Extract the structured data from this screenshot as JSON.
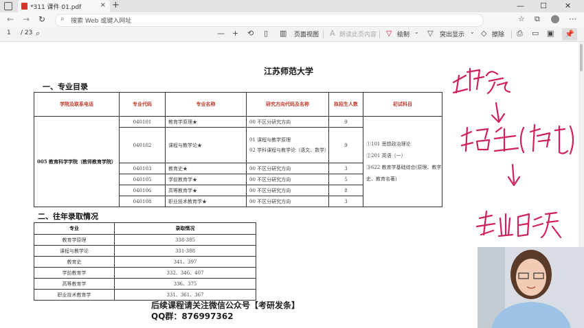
{
  "window": {
    "tab_title": "*311 课件 01.pdf",
    "close_glyph": "×",
    "new_tab_glyph": "+",
    "minimize_glyph": "—",
    "maximize_glyph": "☐",
    "window_close_glyph": "✕"
  },
  "addressbar": {
    "placeholder": "搜索 Web 或键入网址"
  },
  "pdf_toolbar": {
    "page_current": "1",
    "page_total": "/ 23",
    "zoom_out": "—",
    "zoom_in": "+",
    "page_view": "页面视图",
    "read_aloud": "朗读此页内容",
    "draw": "绘制",
    "highlight": "突出显示",
    "erase": "擦除",
    "accent_color": "#d61f3a"
  },
  "document": {
    "title": "江苏师范大学",
    "section1": "一、专业目录",
    "section2": "二、往年录取情况",
    "table1": {
      "headers": [
        "学院及联系电话",
        "专业代码",
        "专业名称",
        "研究方向代码及名称",
        "拟招生人数",
        "初试科目"
      ],
      "college": "005 教育科学学院（教师教育学院）",
      "rows": [
        {
          "code": "040101",
          "name": "教育学原理★",
          "direction": "00 不区分研究方向",
          "count": "9"
        },
        {
          "code": "040102",
          "name": "课程与教学论★",
          "direction_lines": [
            "01 课程与教学原理",
            "02 学科课程与教学论（语文、数学）"
          ],
          "count": "9"
        },
        {
          "code": "040103",
          "name": "教育史★",
          "direction": "00 不区分研究方向",
          "count": "3"
        },
        {
          "code": "040105",
          "name": "学前教育学★",
          "direction": "00 不区分研究方向",
          "count": "5"
        },
        {
          "code": "040106",
          "name": "高等教育学★",
          "direction": "00 不区分研究方向",
          "count": "8"
        },
        {
          "code": "040108",
          "name": "职业技术教育学★",
          "direction": "00 不区分研究方向",
          "count": "3"
        }
      ],
      "subjects": [
        "①101 思想政治理论",
        "②201 英语（一）",
        "③622 教育学基础综合(原理、教学史、教育名著)"
      ]
    },
    "table2": {
      "headers": [
        "专业",
        "录取情况"
      ],
      "rows": [
        [
          "教育学原理",
          "338-385"
        ],
        [
          "课程与教学论",
          "331-388"
        ],
        [
          "教育史",
          "341、397"
        ],
        [
          "学前教育学",
          "332、346、407"
        ],
        [
          "高等教育学",
          "336、375"
        ],
        [
          "职业技术教育学",
          "331、361、367"
        ]
      ]
    }
  },
  "watermark": {
    "line1": "后续课程请关注微信公众号【考研发条】",
    "line2": "QQ群：876997362"
  },
  "annotation": {
    "description": "handwritten notes",
    "color": "#d0205a"
  }
}
